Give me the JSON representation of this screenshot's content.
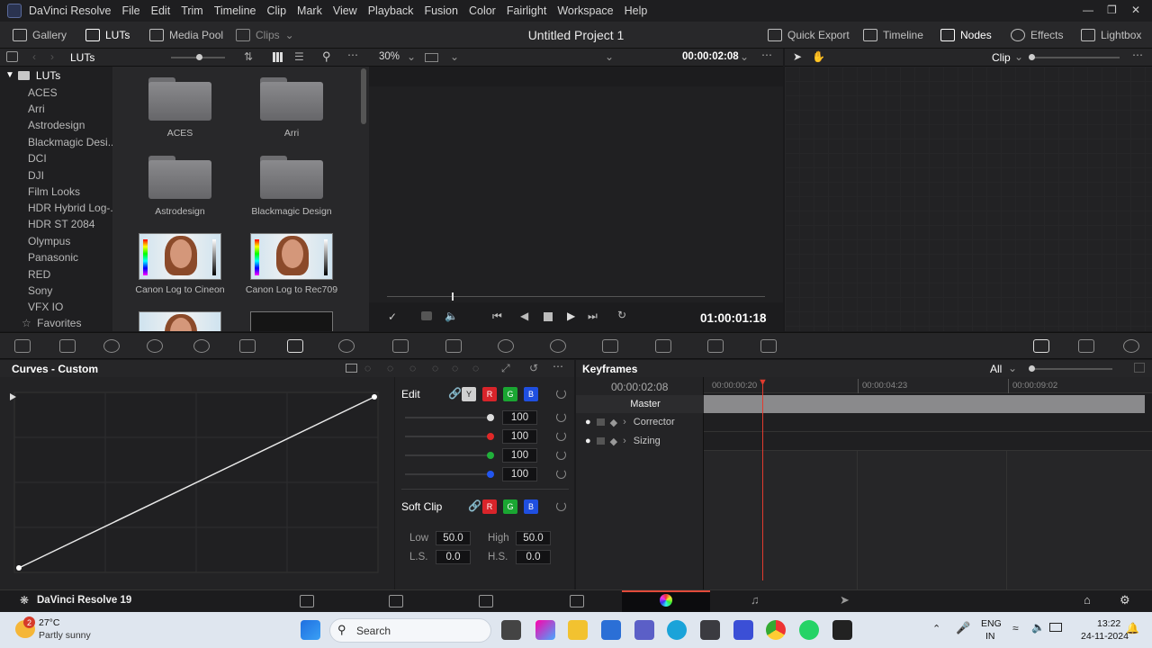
{
  "menu": {
    "app_name": "DaVinci Resolve",
    "items": [
      "File",
      "Edit",
      "Trim",
      "Timeline",
      "Clip",
      "Mark",
      "View",
      "Playback",
      "Fusion",
      "Color",
      "Fairlight",
      "Workspace",
      "Help"
    ]
  },
  "toolbar": {
    "gallery": "Gallery",
    "luts": "LUTs",
    "media_pool": "Media Pool",
    "clips": "Clips",
    "project_title": "Untitled Project 1",
    "quick_export": "Quick Export",
    "timeline": "Timeline",
    "nodes": "Nodes",
    "effects": "Effects",
    "lightbox": "Lightbox"
  },
  "luts_panel": {
    "title": "LUTs",
    "tree_root": "LUTs",
    "tree_items": [
      "ACES",
      "Arri",
      "Astrodesign",
      "Blackmagic Desi...",
      "DCI",
      "DJI",
      "Film Looks",
      "HDR Hybrid Log-...",
      "HDR ST 2084",
      "Olympus",
      "Panasonic",
      "RED",
      "Sony",
      "VFX IO"
    ],
    "favorites": "Favorites",
    "grid": [
      "ACES",
      "Arri",
      "Astrodesign",
      "Blackmagic Design",
      "Canon Log to Cineon",
      "Canon Log to Rec709"
    ]
  },
  "viewer": {
    "zoom": "30%",
    "timecode_top": "00:00:02:08",
    "timecode_bottom": "01:00:01:18"
  },
  "nodes_panel": {
    "mode": "Clip"
  },
  "curves": {
    "title": "Curves - Custom"
  },
  "edit_panel": {
    "edit_label": "Edit",
    "channel_y": "Y",
    "channel_r": "R",
    "channel_g": "G",
    "channel_b": "B",
    "values": [
      "100",
      "100",
      "100",
      "100"
    ],
    "soft_clip": "Soft Clip",
    "low_label": "Low",
    "low": "50.0",
    "high_label": "High",
    "high": "50.0",
    "ls_label": "L.S.",
    "ls": "0.0",
    "hs_label": "H.S.",
    "hs": "0.0"
  },
  "keyframes": {
    "title": "Keyframes",
    "filter": "All",
    "timecode": "00:00:02:08",
    "ruler": [
      "00:00:00:20",
      "00:00:04:23",
      "00:00:09:02"
    ],
    "rows": [
      "Master",
      "Corrector",
      "Sizing"
    ]
  },
  "pagebar": {
    "app_version": "DaVinci Resolve 19"
  },
  "taskbar": {
    "temp": "27°C",
    "weather": "Partly sunny",
    "weather_badge": "2",
    "search": "Search",
    "lang1": "ENG",
    "lang2": "IN",
    "time": "13:22",
    "date": "24-11-2024"
  },
  "colors": {
    "accent_red": "#e23b2e",
    "active_page": "#e04a3a"
  }
}
